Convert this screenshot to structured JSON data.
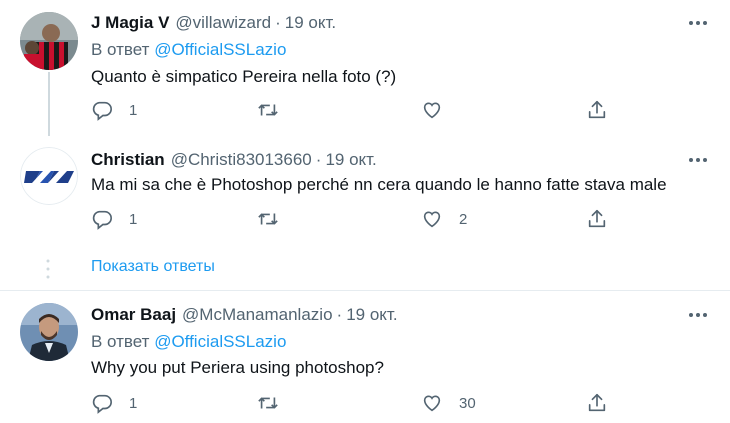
{
  "tweets": [
    {
      "name": "J Magia V",
      "handle": "@villawizard",
      "separator": "·",
      "date": "19 окт.",
      "reply_prefix": "В ответ",
      "reply_mention": "@OfficialSSLazio",
      "text": "Quanto è simpatico Pereira nella foto (?)",
      "replies": "1",
      "retweets": "",
      "likes": ""
    },
    {
      "name": "Christian",
      "handle": "@Christi83013660",
      "separator": "·",
      "date": "19 окт.",
      "text": "Ma mi sa che è Photoshop perché nn cera quando le hanno fatte stava male",
      "replies": "1",
      "retweets": "",
      "likes": "2"
    },
    {
      "name": "Omar Baaj",
      "handle": "@McManamanlazio",
      "separator": "·",
      "date": "19 окт.",
      "reply_prefix": "В ответ",
      "reply_mention": "@OfficialSSLazio",
      "text": "Why you put Periera using photoshop?",
      "replies": "1",
      "retweets": "",
      "likes": "30"
    }
  ],
  "show_replies_label": "Показать ответы",
  "icons": {
    "reply": "reply-icon",
    "retweet": "retweet-icon",
    "like": "heart-icon",
    "share": "share-icon",
    "more": "more-icon"
  },
  "colors": {
    "accent": "#1d9bf0",
    "muted": "#536471",
    "text": "#0f1419",
    "thread_line": "#cfd9de"
  }
}
